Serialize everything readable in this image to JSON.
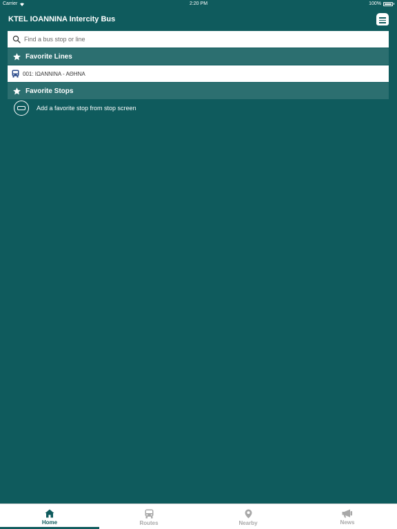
{
  "status_bar": {
    "carrier": "Carrier",
    "time": "2:20 PM",
    "battery": "100%"
  },
  "header": {
    "title": "KTEL IOANNINA Intercity Bus",
    "menu_icon": "menu-icon"
  },
  "search": {
    "placeholder": "Find a bus stop or line",
    "value": ""
  },
  "favorite_lines": {
    "title": "Favorite Lines",
    "items": [
      {
        "label": "001: ΙΩΑΝΝΙΝΑ - ΑΘΗΝΑ",
        "icon": "bus-icon"
      }
    ]
  },
  "favorite_stops": {
    "title": "Favorite Stops",
    "empty_hint": "Add a favorite stop from stop screen"
  },
  "tabs": [
    {
      "label": "Home",
      "icon": "home-icon",
      "active": true
    },
    {
      "label": "Routes",
      "icon": "bus-icon",
      "active": false
    },
    {
      "label": "Nearby",
      "icon": "location-pin-icon",
      "active": false
    },
    {
      "label": "News",
      "icon": "megaphone-icon",
      "active": false
    }
  ],
  "colors": {
    "background": "#0f5b5d",
    "section_header": "#2c6f70",
    "accent_blue": "#2a4a8a",
    "tab_active": "#0f5b5d",
    "tab_inactive": "#a8a8a8"
  }
}
